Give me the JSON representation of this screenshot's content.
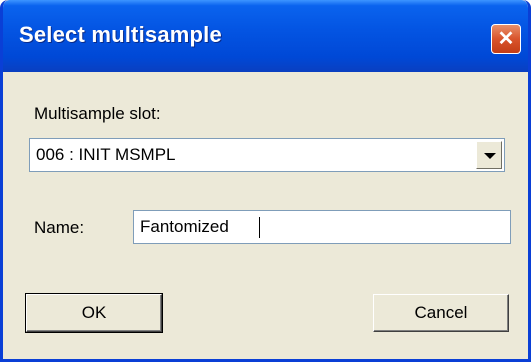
{
  "dialog": {
    "title": "Select multisample",
    "close_glyph": "✕",
    "slot_label": "Multisample slot:",
    "slot_value": "006 : INIT MSMPL",
    "name_label": "Name:",
    "name_value": "Fantomized",
    "ok_label": "OK",
    "cancel_label": "Cancel"
  },
  "icons": {
    "close": "close-icon",
    "dropdown": "chevron-down-icon"
  }
}
